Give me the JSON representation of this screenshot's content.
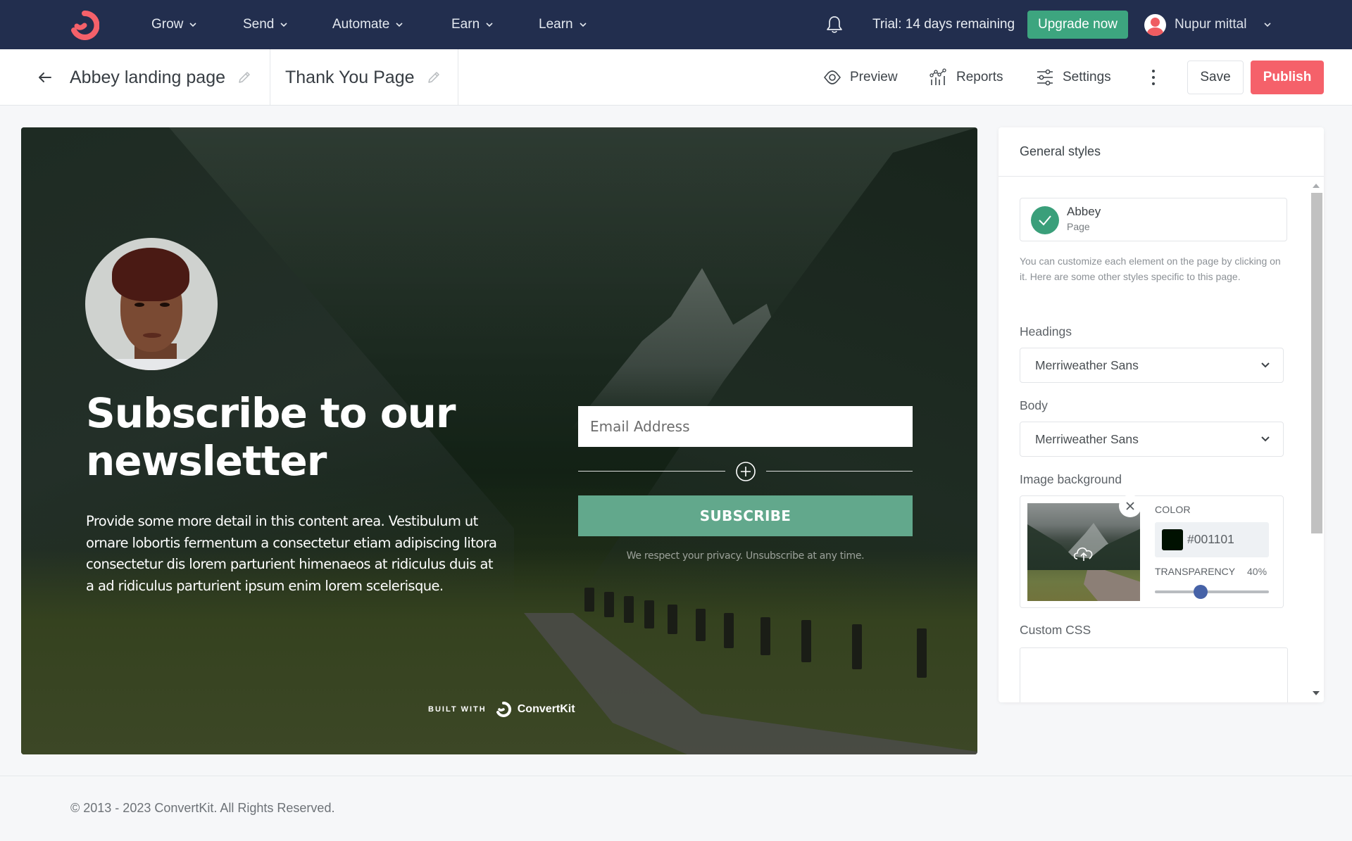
{
  "topnav": {
    "brand": "ConvertKit",
    "items": [
      {
        "label": "Grow"
      },
      {
        "label": "Send"
      },
      {
        "label": "Automate"
      },
      {
        "label": "Earn"
      },
      {
        "label": "Learn"
      }
    ],
    "notifications_icon": "bell-icon",
    "trial_text": "Trial: 14 days remaining",
    "upgrade_label": "Upgrade now",
    "user_name": "Nupur mittal",
    "colors": {
      "bg": "#222e4e",
      "brand": "#f5616a",
      "upgrade": "#3da57f"
    }
  },
  "subheader": {
    "back_icon": "arrow-left-icon",
    "page_title": "Abbey landing page",
    "secondary_title": "Thank You Page",
    "tools": [
      {
        "label": "Preview",
        "icon": "eye-icon"
      },
      {
        "label": "Reports",
        "icon": "chart-icon"
      },
      {
        "label": "Settings",
        "icon": "sliders-icon"
      }
    ],
    "more_icon": "kebab-icon",
    "save_label": "Save",
    "publish_label": "Publish",
    "colors": {
      "publish": "#f5616a"
    }
  },
  "canvas": {
    "headline": "Subscribe to our newsletter",
    "body": "Provide some more detail in this content area. Vestibulum ut ornare lobortis fermentum a consectetur etiam adipiscing litora consectetur dis lorem parturient himenaeos at ridiculus duis at a ad ridiculus parturient ipsum enim lorem scelerisque.",
    "email_placeholder": "Email Address",
    "subscribe_label": "SUBSCRIBE",
    "privacy_text": "We respect your privacy. Unsubscribe at any time.",
    "built_with": "BUILT WITH",
    "built_brand": "ConvertKit",
    "colors": {
      "button": "#62a88c",
      "overlay": "#001101"
    }
  },
  "panel": {
    "title": "General styles",
    "theme": {
      "name": "Abbey",
      "type": "Page"
    },
    "help_text": "You can customize each element on the page by clicking on it. Here are some other styles specific to this page.",
    "headings_label": "Headings",
    "headings_value": "Merriweather Sans",
    "body_label": "Body",
    "body_value": "Merriweather Sans",
    "image_bg_label": "Image background",
    "color_label": "COLOR",
    "color_value": "#001101",
    "transparency_label": "TRANSPARENCY",
    "transparency_value": "40%",
    "transparency_fraction": 0.4,
    "custom_css_label": "Custom CSS",
    "custom_css_value": ""
  },
  "footer": {
    "copyright": "© 2013 - 2023 ConvertKit. All Rights Reserved."
  }
}
